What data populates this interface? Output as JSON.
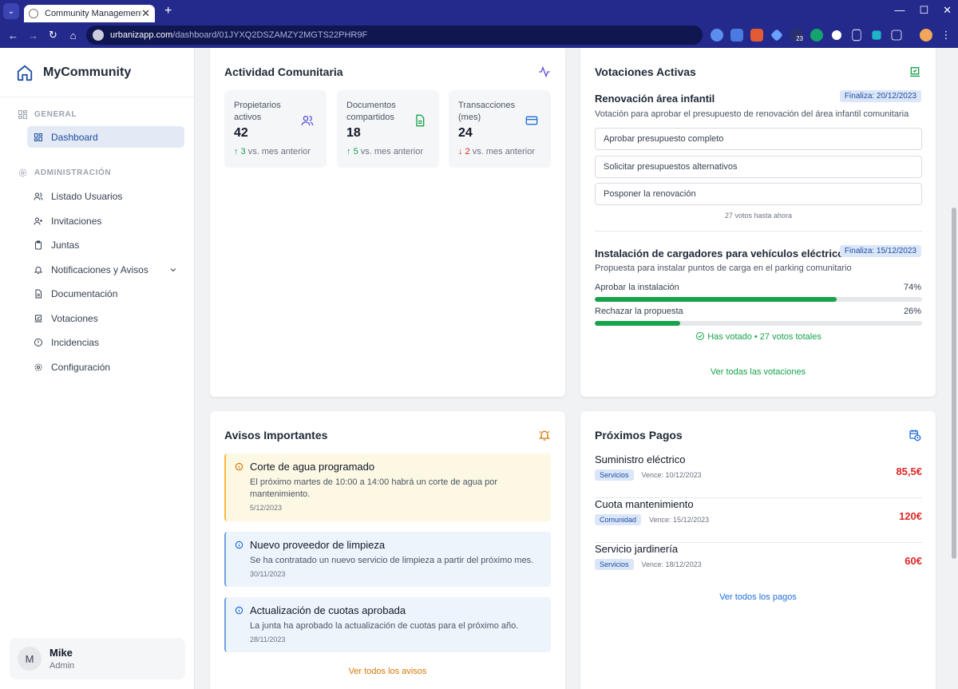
{
  "browser": {
    "tab_title": "Community Management",
    "url_host": "urbanizapp.com",
    "url_path": "/dashboard/01JYXQ2DSZAMZY2MGTS22PHR9F",
    "ext_badge": "23"
  },
  "sidebar": {
    "brand": "MyCommunity",
    "section_general": "GENERAL",
    "dashboard": "Dashboard",
    "section_admin": "ADMINISTRACIÓN",
    "items": [
      "Listado Usuarios",
      "Invitaciones",
      "Juntas",
      "Notificaciones y Avisos",
      "Documentación",
      "Votaciones",
      "Incidencias",
      "Configuración"
    ],
    "user": {
      "initial": "M",
      "name": "Mike",
      "role": "Admin"
    }
  },
  "activity": {
    "title": "Actividad Comunitaria",
    "stats": [
      {
        "label": "Propietarios activos",
        "value": "42",
        "arrow": "↑",
        "delta": "3",
        "suffix": " vs. mes anterior",
        "trend": "up"
      },
      {
        "label": "Documentos compartidos",
        "value": "18",
        "arrow": "↑",
        "delta": "5",
        "suffix": " vs. mes anterior",
        "trend": "up"
      },
      {
        "label": "Transacciones (mes)",
        "value": "24",
        "arrow": "↓",
        "delta": "2",
        "suffix": " vs. mes anterior",
        "trend": "down"
      }
    ]
  },
  "votes": {
    "title": "Votaciones Activas",
    "v1": {
      "title": "Renovación área infantil",
      "badge": "Finaliza: 20/12/2023",
      "desc": "Votación para aprobar el presupuesto de renovación del área infantil comunitaria",
      "options": [
        "Aprobar presupuesto completo",
        "Solicitar presupuestos alternativos",
        "Posponer la renovación"
      ],
      "count": "27 votos hasta ahora"
    },
    "v2": {
      "title": "Instalación de cargadores para vehículos eléctricos",
      "badge": "Finaliza: 15/12/2023",
      "desc": "Propuesta para instalar puntos de carga en el parking comunitario",
      "results": [
        {
          "label": "Aprobar la instalación",
          "pct_text": "74%",
          "pct": 74
        },
        {
          "label": "Rechazar la propuesta",
          "pct_text": "26%",
          "pct": 26
        }
      ],
      "voted": "Has votado • 27 votos totales"
    },
    "link": "Ver todas las votaciones"
  },
  "notices": {
    "title": "Avisos Importantes",
    "items": [
      {
        "title": "Corte de agua programado",
        "body": "El próximo martes de 10:00 a 14:00 habrá un corte de agua por mantenimiento.",
        "date": "5/12/2023"
      },
      {
        "title": "Nuevo proveedor de limpieza",
        "body": "Se ha contratado un nuevo servicio de limpieza a partir del próximo mes.",
        "date": "30/11/2023"
      },
      {
        "title": "Actualización de cuotas aprobada",
        "body": "La junta ha aprobado la actualización de cuotas para el próximo año.",
        "date": "28/11/2023"
      }
    ],
    "link": "Ver todos los avisos"
  },
  "payments": {
    "title": "Próximos Pagos",
    "items": [
      {
        "name": "Suministro eléctrico",
        "tag": "Servicios",
        "due": "Vence: 10/12/2023",
        "amount": "85,5€"
      },
      {
        "name": "Cuota mantenimiento",
        "tag": "Comunidad",
        "due": "Vence: 15/12/2023",
        "amount": "120€"
      },
      {
        "name": "Servicio jardinería",
        "tag": "Servicios",
        "due": "Vence: 18/12/2023",
        "amount": "60€"
      }
    ],
    "link": "Ver todos los pagos"
  },
  "colors": {
    "accent": "#1e4fa3",
    "green": "#16a34a",
    "red": "#dc2626",
    "orange": "#d97706",
    "chrome": "#232a8c"
  }
}
